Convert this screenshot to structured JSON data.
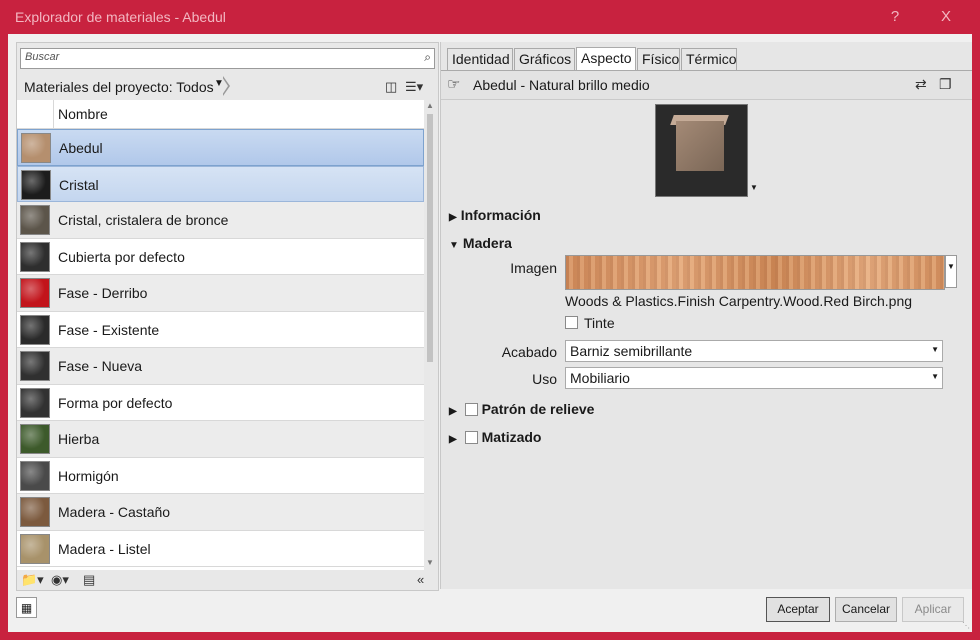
{
  "window": {
    "title": "Explorador de materiales - Abedul",
    "help_label": "?",
    "close_label": "X"
  },
  "library": {
    "search_placeholder": "Buscar",
    "filter_label": "Materiales del proyecto: Todos",
    "column_header": "Nombre",
    "items": [
      {
        "label": "Abedul",
        "state": "selected",
        "swatch": "#b58f6e"
      },
      {
        "label": "Cristal",
        "state": "hover",
        "swatch": "#1c1c1c"
      },
      {
        "label": "Cristal, cristalera de bronce",
        "state": "alt",
        "swatch": "#5c554a"
      },
      {
        "label": "Cubierta por defecto",
        "state": "white",
        "swatch": "#2e2e2e"
      },
      {
        "label": "Fase - Derribo",
        "state": "alt",
        "swatch": "#c2141b"
      },
      {
        "label": "Fase - Existente",
        "state": "white",
        "swatch": "#2a2a2a"
      },
      {
        "label": "Fase - Nueva",
        "state": "alt",
        "swatch": "#303030"
      },
      {
        "label": "Forma por defecto",
        "state": "white",
        "swatch": "#323232"
      },
      {
        "label": "Hierba",
        "state": "alt",
        "swatch": "#3d5a2b"
      },
      {
        "label": "Hormigón",
        "state": "white",
        "swatch": "#4a4a4a"
      },
      {
        "label": "Madera - Castaño",
        "state": "alt",
        "swatch": "#7c5a3e"
      },
      {
        "label": "Madera - Listel",
        "state": "white",
        "swatch": "#a8926a"
      }
    ]
  },
  "editor": {
    "tabs": [
      {
        "label": "Identidad",
        "active": false
      },
      {
        "label": "Gráficos",
        "active": false
      },
      {
        "label": "Aspecto",
        "active": true
      },
      {
        "label": "Físico",
        "active": false
      },
      {
        "label": "Térmico",
        "active": false
      }
    ],
    "asset_name": "Abedul - Natural brillo medio",
    "sections": {
      "informacion": "Información",
      "madera": "Madera",
      "patron": "Patrón de relieve",
      "matizado": "Matizado"
    },
    "imagen_label": "Imagen",
    "image_filename": "Woods & Plastics.Finish Carpentry.Wood.Red Birch.png",
    "tinte_label": "Tinte",
    "acabado_label": "Acabado",
    "acabado_value": "Barniz semibrillante",
    "uso_label": "Uso",
    "uso_value": "Mobiliario"
  },
  "footer": {
    "accept": "Aceptar",
    "cancel": "Cancelar",
    "apply": "Aplicar"
  },
  "colors": {
    "titlebar": "#c8223f",
    "selection": "#b1c8ea"
  }
}
